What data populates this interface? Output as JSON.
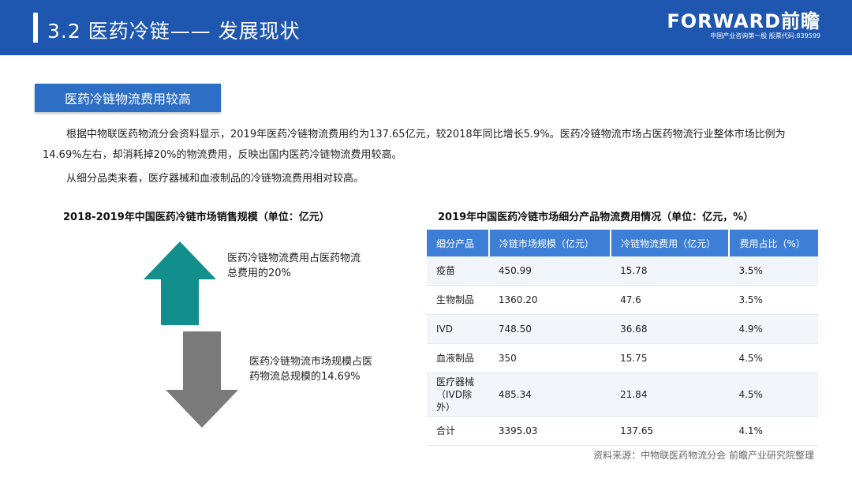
{
  "header": {
    "title": "3.2 医药冷链—— 发展现状",
    "logo_main": "FORWARD前瞻",
    "logo_sub": "中国产业咨询第一股 股票代码:839599"
  },
  "section": {
    "tag": "医药冷链物流费用较高"
  },
  "paragraphs": {
    "p1": "根据中物联医药物流分会资料显示，2019年医药冷链物流费用约为137.65亿元，较2018年同比增长5.9%。医药冷链物流市场占医药物流行业整体市场比例为14.69%左右，却消耗掉20%的物流费用，反映出国内医药冷链物流费用较高。",
    "p2": "从细分品类来看，医疗器械和血液制品的冷链物流费用相对较高。"
  },
  "left_chart": {
    "title": "2018-2019年中国医药冷链市场销售规模（单位：亿元）",
    "note_up": "医药冷链物流费用占医药物流总费用的20%",
    "note_down": "医药冷链物流市场规模占医药物流总规模的14.69%",
    "up_color": "#128e8c",
    "down_color": "#7a7a7a"
  },
  "table": {
    "title": "2019年中国医药冷链市场细分产品物流费用情况（单位：亿元，%）",
    "headers": [
      "细分产品",
      "冷链市场规模（亿元）",
      "冷链物流费用（亿元）",
      "费用占比（%）"
    ],
    "rows": [
      [
        "疫苗",
        "450.99",
        "15.78",
        "3.5%"
      ],
      [
        "生物制品",
        "1360.20",
        "47.6",
        "3.5%"
      ],
      [
        "IVD",
        "748.50",
        "36.68",
        "4.9%"
      ],
      [
        "血液制品",
        "350",
        "15.75",
        "4.5%"
      ],
      [
        "医疗器械（IVD除外）",
        "485.34",
        "21.84",
        "4.5%"
      ],
      [
        "合计",
        "3395.03",
        "137.65",
        "4.1%"
      ]
    ]
  },
  "source": "资料来源：中物联医药物流分会 前瞻产业研究院整理",
  "colors": {
    "header_bg": "#1f57b0",
    "section_tag_bg": "#2e6fc6",
    "table_header_bg": "#3d7fd6"
  }
}
